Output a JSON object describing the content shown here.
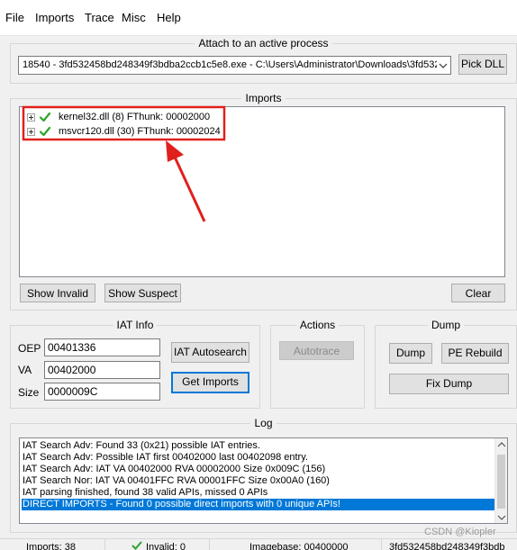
{
  "menu": [
    "File",
    "Imports",
    "Trace",
    "Misc",
    "Help"
  ],
  "attach": {
    "title": "Attach to an active process",
    "process_value": "18540 - 3fd532458bd248349f3bdba2ccb1c5e8.exe - C:\\Users\\Administrator\\Downloads\\3fd532",
    "pick_dll_label": "Pick DLL"
  },
  "imports": {
    "title": "Imports",
    "items": [
      {
        "label": "kernel32.dll (8) FThunk: 00002000"
      },
      {
        "label": "msvcr120.dll (30) FThunk: 00002024"
      }
    ],
    "show_invalid_label": "Show Invalid",
    "show_suspect_label": "Show Suspect",
    "clear_label": "Clear"
  },
  "iat_info": {
    "title": "IAT Info",
    "oep_label": "OEP",
    "oep_value": "00401336",
    "va_label": "VA",
    "va_value": "00402000",
    "size_label": "Size",
    "size_value": "0000009C",
    "autosearch_label": "IAT Autosearch",
    "get_imports_label": "Get Imports"
  },
  "actions": {
    "title": "Actions",
    "autotrace_label": "Autotrace"
  },
  "dump": {
    "title": "Dump",
    "dump_label": "Dump",
    "pe_rebuild_label": "PE Rebuild",
    "fix_dump_label": "Fix Dump"
  },
  "log": {
    "title": "Log",
    "lines": [
      "IAT Search Adv: Found 33 (0x21) possible IAT entries.",
      "IAT Search Adv: Possible IAT first 00402000 last 00402098 entry.",
      "IAT Search Adv: IAT VA 00402000 RVA 00002000 Size 0x009C (156)",
      "IAT Search Nor: IAT VA 00401FFC RVA 00001FFC Size 0x00A0 (160)",
      "IAT parsing finished, found 38 valid APIs, missed 0 APIs",
      "DIRECT IMPORTS - Found 0 possible direct imports with 0 unique APIs!"
    ]
  },
  "status": {
    "imports": "Imports: 38",
    "invalid": "Invalid: 0",
    "imagebase": "Imagebase: 00400000",
    "module": "3fd532458bd248349f3bdb"
  },
  "watermark": "CSDN @Kiopler",
  "colors": {
    "annotation": "#e0201c",
    "selection": "#0078d7",
    "check": "#2da42d"
  }
}
